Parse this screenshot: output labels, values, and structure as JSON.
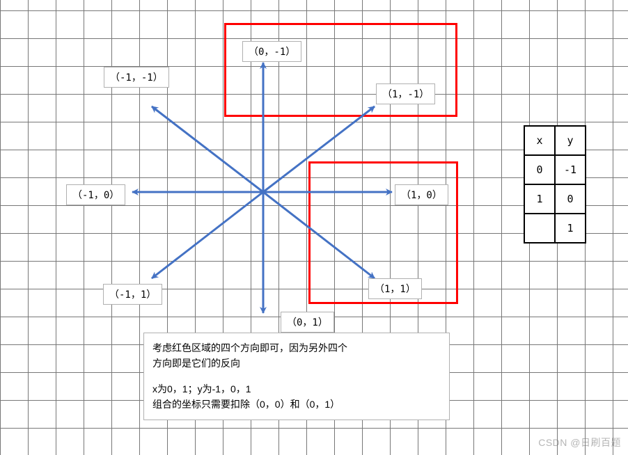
{
  "labels": {
    "n": "（0，-1）",
    "ne": "（1，-1）",
    "e": "（1，0）",
    "se": "（1，1）",
    "s": "（0，1）",
    "sw": "（-1，1）",
    "w": "（-1，0）",
    "nw": "（-1，-1）"
  },
  "table": {
    "head_x": "x",
    "head_y": "y",
    "rows": [
      [
        "0",
        "-1"
      ],
      [
        "1",
        "0"
      ],
      [
        "",
        "1"
      ]
    ]
  },
  "note": {
    "line1": "考虑红色区域的四个方向即可，因为另外四个",
    "line2": "方向即是它们的反向",
    "line3": "x为0，1；y为-1，0，1",
    "line4": "组合的坐标只需要扣除（0，0）和（0，1）"
  },
  "watermark": "CSDN @日刷百题",
  "chart_data": {
    "type": "diagram",
    "center": [
      0,
      0
    ],
    "arrows": [
      {
        "dx": 0,
        "dy": -1,
        "label": "（0，-1）",
        "highlighted": true
      },
      {
        "dx": 1,
        "dy": -1,
        "label": "（1，-1）",
        "highlighted": true
      },
      {
        "dx": 1,
        "dy": 0,
        "label": "（1，0）",
        "highlighted": true
      },
      {
        "dx": 1,
        "dy": 1,
        "label": "（1，1）",
        "highlighted": true
      },
      {
        "dx": 0,
        "dy": 1,
        "label": "（0，1）",
        "highlighted": false
      },
      {
        "dx": -1,
        "dy": 1,
        "label": "（-1，1）",
        "highlighted": false
      },
      {
        "dx": -1,
        "dy": 0,
        "label": "（-1，0）",
        "highlighted": false
      },
      {
        "dx": -1,
        "dy": -1,
        "label": "（-1，-1）",
        "highlighted": false
      }
    ],
    "highlight_regions": 2,
    "title": "",
    "annotation": "考虑红色区域的四个方向即可，因为另外四个方向即是它们的反向；x为0，1；y为-1，0，1；组合的坐标只需要扣除（0，0）和（0，1）"
  }
}
